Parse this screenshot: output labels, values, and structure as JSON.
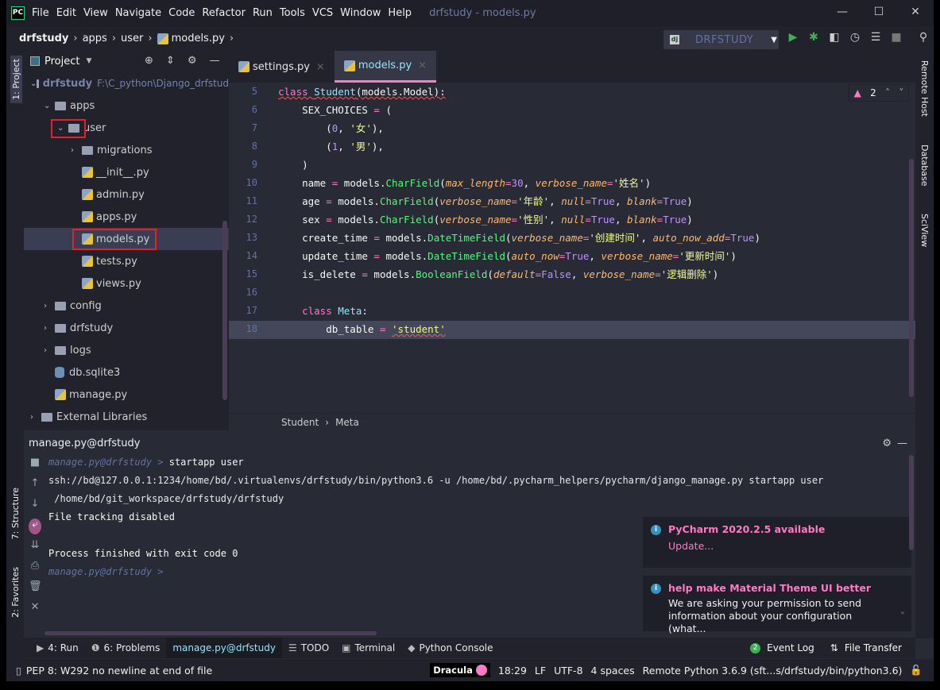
{
  "window": {
    "title": "drfstudy - models.py",
    "logo": "PC",
    "controls": [
      "—",
      "☐",
      "✕"
    ]
  },
  "menu": [
    "File",
    "Edit",
    "View",
    "Navigate",
    "Code",
    "Refactor",
    "Run",
    "Tools",
    "VCS",
    "Window",
    "Help"
  ],
  "breadcrumb": [
    "drfstudy",
    "apps",
    "user",
    "models.py"
  ],
  "run_config": {
    "name": "DRFSTUDY",
    "icon": "dj"
  },
  "toolbar_icons": [
    "run-icon",
    "debug-icon",
    "coverage-icon",
    "profile-icon",
    "concurrency-icon",
    "stop-icon",
    "search-icon"
  ],
  "left_tabs": {
    "project": "1: Project",
    "structure": "7: Structure",
    "favorites": "2: Favorites"
  },
  "right_tabs": [
    "Remote Host",
    "Database",
    "SciView"
  ],
  "project": {
    "title": "Project",
    "tree": [
      {
        "label": "drfstudy",
        "hint": "F:\\C_python\\Django_drfstud",
        "type": "folder",
        "depth": 0,
        "open": true,
        "bold": true
      },
      {
        "label": "apps",
        "type": "folder",
        "depth": 1,
        "open": true
      },
      {
        "label": "user",
        "type": "folder",
        "depth": 2,
        "open": true
      },
      {
        "label": "migrations",
        "type": "folder",
        "depth": 3,
        "open": false
      },
      {
        "label": "__init__.py",
        "type": "py",
        "depth": 3
      },
      {
        "label": "admin.py",
        "type": "py",
        "depth": 3
      },
      {
        "label": "apps.py",
        "type": "py",
        "depth": 3
      },
      {
        "label": "models.py",
        "type": "py",
        "depth": 3,
        "selected": true
      },
      {
        "label": "tests.py",
        "type": "py",
        "depth": 3
      },
      {
        "label": "views.py",
        "type": "py",
        "depth": 3
      },
      {
        "label": "config",
        "type": "folder",
        "depth": 1,
        "open": false
      },
      {
        "label": "drfstudy",
        "type": "folder",
        "depth": 1,
        "open": false
      },
      {
        "label": "logs",
        "type": "folder",
        "depth": 1,
        "open": false
      },
      {
        "label": "db.sqlite3",
        "type": "db",
        "depth": 1
      },
      {
        "label": "manage.py",
        "type": "py",
        "depth": 1
      },
      {
        "label": "External Libraries",
        "type": "lib",
        "depth": 0,
        "open": false
      }
    ]
  },
  "editor": {
    "tabs": [
      {
        "label": "settings.py",
        "active": false
      },
      {
        "label": "models.py",
        "active": true
      }
    ],
    "warnings": "2",
    "current_line": 18,
    "lines": [
      {
        "n": 5,
        "t": [
          [
            "kw sq",
            "class "
          ],
          [
            "cls sq",
            "Student"
          ],
          [
            "tx sq",
            "(models.Model):"
          ]
        ]
      },
      {
        "n": 6,
        "t": [
          [
            "tx",
            "    SEX_CHOICES "
          ],
          [
            "op",
            "= "
          ],
          [
            "tx",
            "("
          ]
        ]
      },
      {
        "n": 7,
        "t": [
          [
            "tx",
            "        ("
          ],
          [
            "num",
            "0"
          ],
          [
            "tx",
            ", "
          ],
          [
            "str",
            "'女'"
          ],
          [
            "tx",
            "),"
          ]
        ]
      },
      {
        "n": 8,
        "t": [
          [
            "tx",
            "        ("
          ],
          [
            "num",
            "1"
          ],
          [
            "tx",
            ", "
          ],
          [
            "str",
            "'男'"
          ],
          [
            "tx",
            "),"
          ]
        ]
      },
      {
        "n": 9,
        "t": [
          [
            "tx",
            "    )"
          ]
        ]
      },
      {
        "n": 10,
        "t": [
          [
            "tx",
            "    name "
          ],
          [
            "op",
            "= "
          ],
          [
            "tx",
            "models."
          ],
          [
            "fn",
            "CharField"
          ],
          [
            "tx",
            "("
          ],
          [
            "par",
            "max_length"
          ],
          [
            "op",
            "="
          ],
          [
            "num",
            "30"
          ],
          [
            "tx",
            ", "
          ],
          [
            "par",
            "verbose_name"
          ],
          [
            "op",
            "="
          ],
          [
            "str",
            "'姓名'"
          ],
          [
            "tx",
            ")"
          ]
        ]
      },
      {
        "n": 11,
        "t": [
          [
            "tx",
            "    age "
          ],
          [
            "op",
            "= "
          ],
          [
            "tx",
            "models."
          ],
          [
            "fn",
            "CharField"
          ],
          [
            "tx",
            "("
          ],
          [
            "par",
            "verbose_name"
          ],
          [
            "op",
            "="
          ],
          [
            "str",
            "'年龄'"
          ],
          [
            "tx",
            ", "
          ],
          [
            "par",
            "null"
          ],
          [
            "op",
            "="
          ],
          [
            "cn",
            "True"
          ],
          [
            "tx",
            ", "
          ],
          [
            "par",
            "blank"
          ],
          [
            "op",
            "="
          ],
          [
            "cn",
            "True"
          ],
          [
            "tx",
            ")"
          ]
        ]
      },
      {
        "n": 12,
        "t": [
          [
            "tx",
            "    sex "
          ],
          [
            "op",
            "= "
          ],
          [
            "tx",
            "models."
          ],
          [
            "fn",
            "CharField"
          ],
          [
            "tx",
            "("
          ],
          [
            "par",
            "verbose_name"
          ],
          [
            "op",
            "="
          ],
          [
            "str",
            "'性别'"
          ],
          [
            "tx",
            ", "
          ],
          [
            "par",
            "null"
          ],
          [
            "op",
            "="
          ],
          [
            "cn",
            "True"
          ],
          [
            "tx",
            ", "
          ],
          [
            "par",
            "blank"
          ],
          [
            "op",
            "="
          ],
          [
            "cn",
            "True"
          ],
          [
            "tx",
            ")"
          ]
        ]
      },
      {
        "n": 13,
        "t": [
          [
            "tx",
            "    create_time "
          ],
          [
            "op",
            "= "
          ],
          [
            "tx",
            "models."
          ],
          [
            "fn",
            "DateTimeField"
          ],
          [
            "tx",
            "("
          ],
          [
            "par",
            "verbose_name"
          ],
          [
            "op",
            "="
          ],
          [
            "str",
            "'创建时间'"
          ],
          [
            "tx",
            ", "
          ],
          [
            "par",
            "auto_now_add"
          ],
          [
            "op",
            "="
          ],
          [
            "cn",
            "True"
          ],
          [
            "tx",
            ")"
          ]
        ]
      },
      {
        "n": 14,
        "t": [
          [
            "tx",
            "    update_time "
          ],
          [
            "op",
            "= "
          ],
          [
            "tx",
            "models."
          ],
          [
            "fn",
            "DateTimeField"
          ],
          [
            "tx",
            "("
          ],
          [
            "par",
            "auto_now"
          ],
          [
            "op",
            "="
          ],
          [
            "cn",
            "True"
          ],
          [
            "tx",
            ", "
          ],
          [
            "par",
            "verbose_name"
          ],
          [
            "op",
            "="
          ],
          [
            "str",
            "'更新时间'"
          ],
          [
            "tx",
            ")"
          ]
        ]
      },
      {
        "n": 15,
        "t": [
          [
            "tx",
            "    is_delete "
          ],
          [
            "op",
            "= "
          ],
          [
            "tx",
            "models."
          ],
          [
            "fn",
            "BooleanField"
          ],
          [
            "tx",
            "("
          ],
          [
            "par",
            "default"
          ],
          [
            "op",
            "="
          ],
          [
            "cn",
            "False"
          ],
          [
            "tx",
            ", "
          ],
          [
            "par",
            "verbose_name"
          ],
          [
            "op",
            "="
          ],
          [
            "str",
            "'逻辑删除'"
          ],
          [
            "tx",
            ")"
          ]
        ]
      },
      {
        "n": 16,
        "t": []
      },
      {
        "n": 17,
        "t": [
          [
            "kw",
            "    class "
          ],
          [
            "cls",
            "Meta"
          ],
          [
            "tx",
            ":"
          ]
        ]
      },
      {
        "n": 18,
        "t": [
          [
            "tx",
            "        db_table "
          ],
          [
            "op",
            "= "
          ],
          [
            "str sq",
            "'student'"
          ]
        ]
      }
    ],
    "crumbs": [
      "Student",
      "Meta"
    ]
  },
  "run": {
    "title": "manage.py@drfstudy",
    "console": [
      {
        "prompt": "manage.py@drfstudy > ",
        "text": "startapp user"
      },
      {
        "text": "ssh://bd@127.0.0.1:1234/home/bd/.virtualenvs/drfstudy/bin/python3.6 -u /home/bd/.pycharm_helpers/pycharm/django_manage.py startapp user"
      },
      {
        "text": " /home/bd/git_workspace/drfstudy/drfstudy"
      },
      {
        "text": "File tracking disabled"
      },
      {
        "text": ""
      },
      {
        "text": "Process finished with exit code 0"
      },
      {
        "prompt": "manage.py@drfstudy > ",
        "text": ""
      }
    ]
  },
  "notifications": [
    {
      "title": "PyCharm 2020.2.5 available",
      "link": "Update..."
    },
    {
      "title": "help make Material Theme UI better",
      "body": "We are asking your permission to send information about your configuration (what..."
    }
  ],
  "bottom_tabs": [
    {
      "label": "4: Run",
      "icon": "▶"
    },
    {
      "label": "6: Problems",
      "icon": "❶"
    },
    {
      "label": "manage.py@drfstudy",
      "active": true
    },
    {
      "label": "TODO",
      "icon": "☰"
    },
    {
      "label": "Terminal",
      "icon": "▣"
    },
    {
      "label": "Python Console",
      "icon": "◆"
    }
  ],
  "bottom_right": {
    "event_log": "Event Log",
    "event_count": "2",
    "file_transfer": "File Transfer"
  },
  "status": {
    "message": "PEP 8: W292 no newline at end of file",
    "theme": "Dracula",
    "position": "18:29",
    "line_sep": "LF",
    "encoding": "UTF-8",
    "indent": "4 spaces",
    "interpreter": "Remote Python 3.6.9 (sft...s/drfstudy/bin/python3.6)"
  },
  "colors": {
    "accent": "#ff79c6",
    "bg": "#282a36",
    "panel": "#21222c"
  }
}
